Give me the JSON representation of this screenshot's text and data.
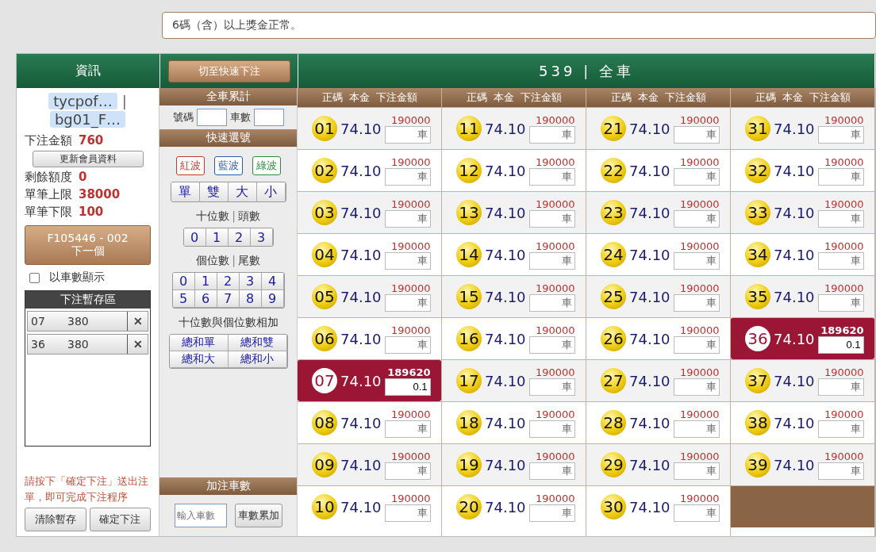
{
  "notice": "6碼（含）以上獎金正常。",
  "left_panel": {
    "title": "資訊",
    "user": [
      "tycpof…",
      "|",
      "bg01_F…"
    ],
    "stats": [
      {
        "label": "下注金額",
        "value": "760"
      },
      {
        "label": "剩餘額度",
        "value": "0"
      },
      {
        "label": "單筆上限",
        "value": "38000"
      },
      {
        "label": "單筆下限",
        "value": "100"
      }
    ],
    "refresh_button": "更新會員資料",
    "next_button": {
      "code": "F105446 - 002",
      "label": "下一個"
    },
    "show_by_count": {
      "label": "以車數顯示",
      "checked": false
    },
    "bet_buffer": {
      "title": "下注暫存區",
      "items": [
        {
          "number": "07",
          "amount": "380",
          "remove": "✕"
        },
        {
          "number": "36",
          "amount": "380",
          "remove": "✕"
        }
      ]
    },
    "note": "請按下「確定下注」送出注單，即可完成下注程序",
    "buttons": [
      "清除暫存",
      "確定下注"
    ]
  },
  "middle_panel": {
    "switch_button": "切至快速下注",
    "total_title": "全車累計",
    "total_fields": [
      "號碼",
      "車數"
    ],
    "quick_title": "快速選號",
    "waves": [
      {
        "label": "紅波",
        "color": "#c0392b"
      },
      {
        "label": "藍波",
        "color": "#2a5caa"
      },
      {
        "label": "綠波",
        "color": "#2e8b3e"
      }
    ],
    "parity": [
      "單",
      "雙",
      "大",
      "小"
    ],
    "tens_label": [
      "十位數",
      "|",
      "頭數"
    ],
    "tens": [
      "0",
      "1",
      "2",
      "3"
    ],
    "units_label": [
      "個位數",
      "|",
      "尾數"
    ],
    "units": [
      "0",
      "1",
      "2",
      "3",
      "4",
      "5",
      "6",
      "7",
      "8",
      "9"
    ],
    "sum_label": "十位數與個位數相加",
    "sums": [
      "總和單",
      "總和雙",
      "總和大",
      "總和小"
    ],
    "add_title": "加注車數",
    "add_placeholder": "輸入車數",
    "add_button": "車數累加"
  },
  "board": {
    "title": "539 | 全車",
    "columns": [
      {
        "header": [
          "正碼",
          "本金",
          "下注金額"
        ],
        "cells": [
          {
            "number": "01",
            "odds": "74.10",
            "limit": "190000",
            "placeholder": "車",
            "selected": false
          },
          {
            "number": "02",
            "odds": "74.10",
            "limit": "190000",
            "placeholder": "車",
            "selected": false
          },
          {
            "number": "03",
            "odds": "74.10",
            "limit": "190000",
            "placeholder": "車",
            "selected": false
          },
          {
            "number": "04",
            "odds": "74.10",
            "limit": "190000",
            "placeholder": "車",
            "selected": false
          },
          {
            "number": "05",
            "odds": "74.10",
            "limit": "190000",
            "placeholder": "車",
            "selected": false
          },
          {
            "number": "06",
            "odds": "74.10",
            "limit": "190000",
            "placeholder": "車",
            "selected": false
          },
          {
            "number": "07",
            "odds": "74.10",
            "limit": "189620",
            "value": "0.1",
            "selected": true
          },
          {
            "number": "08",
            "odds": "74.10",
            "limit": "190000",
            "placeholder": "車",
            "selected": false
          },
          {
            "number": "09",
            "odds": "74.10",
            "limit": "190000",
            "placeholder": "車",
            "selected": false
          },
          {
            "number": "10",
            "odds": "74.10",
            "limit": "190000",
            "placeholder": "車",
            "selected": false
          }
        ]
      },
      {
        "header": [
          "正碼",
          "本金",
          "下注金額"
        ],
        "cells": [
          {
            "number": "11",
            "odds": "74.10",
            "limit": "190000",
            "placeholder": "車",
            "selected": false
          },
          {
            "number": "12",
            "odds": "74.10",
            "limit": "190000",
            "placeholder": "車",
            "selected": false
          },
          {
            "number": "13",
            "odds": "74.10",
            "limit": "190000",
            "placeholder": "車",
            "selected": false
          },
          {
            "number": "14",
            "odds": "74.10",
            "limit": "190000",
            "placeholder": "車",
            "selected": false
          },
          {
            "number": "15",
            "odds": "74.10",
            "limit": "190000",
            "placeholder": "車",
            "selected": false
          },
          {
            "number": "16",
            "odds": "74.10",
            "limit": "190000",
            "placeholder": "車",
            "selected": false
          },
          {
            "number": "17",
            "odds": "74.10",
            "limit": "190000",
            "placeholder": "車",
            "selected": false
          },
          {
            "number": "18",
            "odds": "74.10",
            "limit": "190000",
            "placeholder": "車",
            "selected": false
          },
          {
            "number": "19",
            "odds": "74.10",
            "limit": "190000",
            "placeholder": "車",
            "selected": false
          },
          {
            "number": "20",
            "odds": "74.10",
            "limit": "190000",
            "placeholder": "車",
            "selected": false
          }
        ]
      },
      {
        "header": [
          "正碼",
          "本金",
          "下注金額"
        ],
        "cells": [
          {
            "number": "21",
            "odds": "74.10",
            "limit": "190000",
            "placeholder": "車",
            "selected": false
          },
          {
            "number": "22",
            "odds": "74.10",
            "limit": "190000",
            "placeholder": "車",
            "selected": false
          },
          {
            "number": "23",
            "odds": "74.10",
            "limit": "190000",
            "placeholder": "車",
            "selected": false
          },
          {
            "number": "24",
            "odds": "74.10",
            "limit": "190000",
            "placeholder": "車",
            "selected": false
          },
          {
            "number": "25",
            "odds": "74.10",
            "limit": "190000",
            "placeholder": "車",
            "selected": false
          },
          {
            "number": "26",
            "odds": "74.10",
            "limit": "190000",
            "placeholder": "車",
            "selected": false
          },
          {
            "number": "27",
            "odds": "74.10",
            "limit": "190000",
            "placeholder": "車",
            "selected": false
          },
          {
            "number": "28",
            "odds": "74.10",
            "limit": "190000",
            "placeholder": "車",
            "selected": false
          },
          {
            "number": "29",
            "odds": "74.10",
            "limit": "190000",
            "placeholder": "車",
            "selected": false
          },
          {
            "number": "30",
            "odds": "74.10",
            "limit": "190000",
            "placeholder": "車",
            "selected": false
          }
        ]
      },
      {
        "header": [
          "正碼",
          "本金",
          "下注金額"
        ],
        "cells": [
          {
            "number": "31",
            "odds": "74.10",
            "limit": "190000",
            "placeholder": "車",
            "selected": false
          },
          {
            "number": "32",
            "odds": "74.10",
            "limit": "190000",
            "placeholder": "車",
            "selected": false
          },
          {
            "number": "33",
            "odds": "74.10",
            "limit": "190000",
            "placeholder": "車",
            "selected": false
          },
          {
            "number": "34",
            "odds": "74.10",
            "limit": "190000",
            "placeholder": "車",
            "selected": false
          },
          {
            "number": "35",
            "odds": "74.10",
            "limit": "190000",
            "placeholder": "車",
            "selected": false
          },
          {
            "number": "36",
            "odds": "74.10",
            "limit": "189620",
            "value": "0.1",
            "selected": true
          },
          {
            "number": "37",
            "odds": "74.10",
            "limit": "190000",
            "placeholder": "車",
            "selected": false
          },
          {
            "number": "38",
            "odds": "74.10",
            "limit": "190000",
            "placeholder": "車",
            "selected": false
          },
          {
            "number": "39",
            "odds": "74.10",
            "limit": "190000",
            "placeholder": "車",
            "selected": false
          }
        ]
      }
    ]
  }
}
